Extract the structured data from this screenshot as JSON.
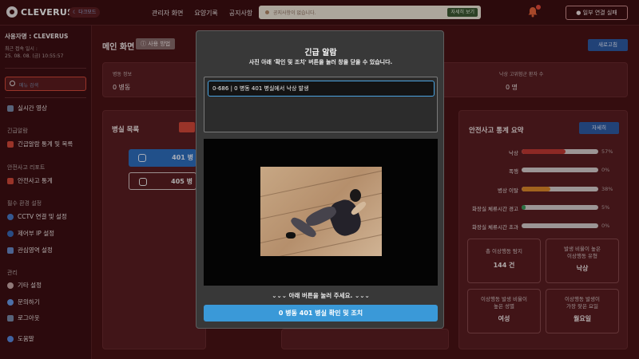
{
  "header": {
    "logo_text": "CLEVERUS",
    "dark_mode_label": "다크모드",
    "nav": [
      "관리자 화면",
      "요양기록",
      "공지사항"
    ],
    "notice_text": "공지사항이 없습니다.",
    "notice_button": "자세히 보기",
    "partial_connect_label": "일부 연결 실패"
  },
  "sidebar": {
    "user": "사용자명 : CLEVERUS",
    "last_login_label": "최근 접속 일시 :",
    "last_login": "25. 08. 08. (금) 10:55:57",
    "search_placeholder": "메뉴 검색",
    "live_video": "실시간 영상",
    "sections": [
      {
        "label": "긴급알람",
        "items": [
          "긴급알람 통계 및 목록"
        ]
      },
      {
        "label": "안전사고 리포트",
        "items": [
          "안전사고 통계"
        ]
      },
      {
        "label": "필수 환경 설정",
        "items": [
          "CCTV 연결 및 설정",
          "제어부 IP 설정",
          "관심영역 설정"
        ]
      },
      {
        "label": "관리",
        "items": [
          "기타 설정",
          "문의하기",
          "로그아웃"
        ]
      }
    ],
    "help": "도움말"
  },
  "main": {
    "title": "메인 화면",
    "guide_button": "사용 방법",
    "refresh_button": "새로고침",
    "ward_info_label": "병동 정보",
    "ward_info_value": "0 병동",
    "fall_risk_label": "낙상 고위험군 환자 수",
    "fall_risk_value": "0 명",
    "room_list_title": "병실 목록",
    "rooms": [
      {
        "label": "401 병",
        "active": true
      },
      {
        "label": "405 병",
        "active": false
      }
    ],
    "safety_title": "안전사고 통계 요약",
    "detail_button": "자세히",
    "stats": [
      {
        "label": "낙상",
        "value": 57,
        "pct": "57%",
        "color": "#c43a34"
      },
      {
        "label": "폭행",
        "value": 0,
        "pct": "0%",
        "color": "#c43a34"
      },
      {
        "label": "병상 이탈",
        "value": 38,
        "pct": "38%",
        "color": "#e08a2a"
      },
      {
        "label": "화장실 체류시간 경고",
        "value": 5,
        "pct": "5%",
        "color": "#3a9a5a"
      },
      {
        "label": "화장실 체류시간 초과",
        "value": 0,
        "pct": "0%",
        "color": "#c43a34"
      }
    ],
    "boxes": [
      {
        "title": "총 이상행동 탐지",
        "value": "144 건"
      },
      {
        "title": "발생 비율이 높은\n이상행동 유형",
        "value": "낙상"
      },
      {
        "title": "이상행동 발생 비율이\n높은 성별",
        "value": "여성"
      },
      {
        "title": "이상행동 발생이\n가장 잦은 요일",
        "value": "월요일"
      }
    ]
  },
  "modal": {
    "title": "긴급 알람",
    "subtitle": "사진 아래 '확인 및 조치' 버튼을 눌러 창을 닫을 수 있습니다.",
    "alert_item": "0-686 | 0 병동 401 병실에서 낙상 발생",
    "hint": "⌄⌄⌄  아래 버튼을 눌러 주세요.  ⌄⌄⌄",
    "confirm_button": "0 병동 401 병실 확인 및 조치"
  },
  "colors": {
    "accent_red": "#d4493a",
    "accent_blue": "#3a99d8",
    "background": "#4a1316"
  }
}
